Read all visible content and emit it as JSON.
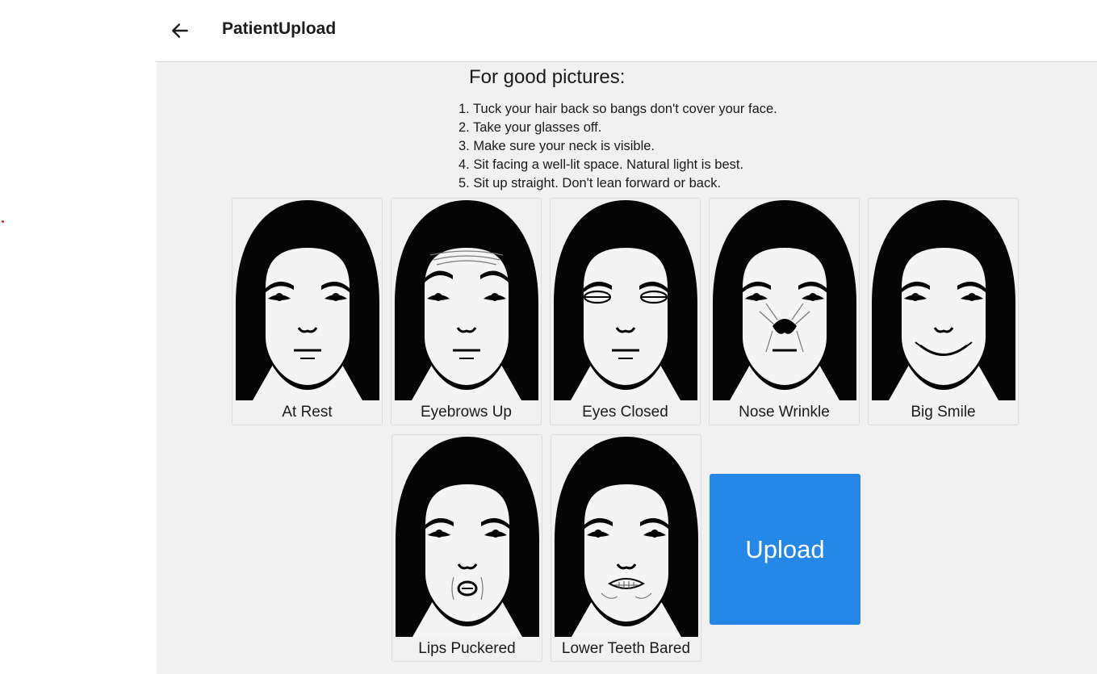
{
  "header": {
    "title": "PatientUpload",
    "back_icon": "arrow-left-icon"
  },
  "instructions": {
    "title": "For good pictures:",
    "items": [
      "1. Tuck your hair back so bangs don't cover your face.",
      "2. Take your glasses off.",
      "3. Make sure your neck is visible.",
      "4. Sit facing a well-lit space. Natural light is best.",
      "5. Sit up straight. Don't lean forward or back."
    ]
  },
  "expressions": [
    {
      "label": "At Rest",
      "icon": "face-at-rest-icon"
    },
    {
      "label": "Eyebrows Up",
      "icon": "face-eyebrows-up-icon"
    },
    {
      "label": "Eyes Closed",
      "icon": "face-eyes-closed-icon"
    },
    {
      "label": "Nose Wrinkle",
      "icon": "face-nose-wrinkle-icon"
    },
    {
      "label": "Big Smile",
      "icon": "face-big-smile-icon"
    },
    {
      "label": "Lips Puckered",
      "icon": "face-lips-puckered-icon"
    },
    {
      "label": "Lower Teeth Bared",
      "icon": "face-lower-teeth-bared-icon"
    }
  ],
  "upload": {
    "label": "Upload"
  },
  "colors": {
    "accent": "#2588e8",
    "background": "#f1f1f1",
    "indicator": "#d0242b"
  }
}
